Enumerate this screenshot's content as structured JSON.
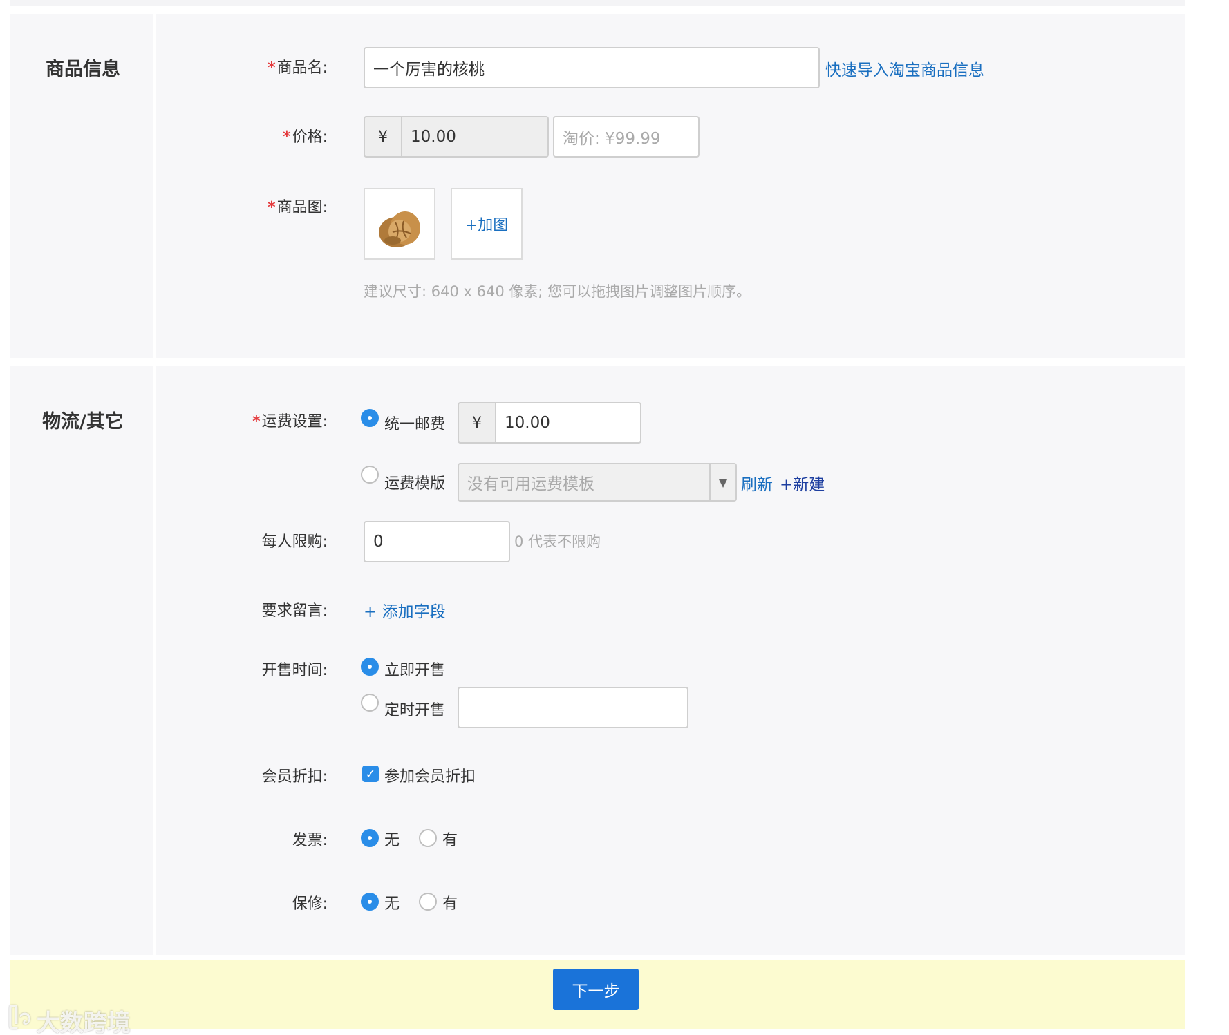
{
  "sections": {
    "product_info_title": "商品信息",
    "logistics_title": "物流/其它"
  },
  "product": {
    "name_label": "商品名:",
    "name_value": "一个厉害的核桃",
    "import_link": "快速导入淘宝商品信息",
    "price_label": "价格:",
    "currency": "¥",
    "price_value": "10.00",
    "taobao_price_placeholder": "淘价: ¥99.99",
    "image_label": "商品图:",
    "add_image": "+加图",
    "image_hint": "建议尺寸: 640 x 640 像素; 您可以拖拽图片调整图片顺序。"
  },
  "logistics": {
    "shipping_label": "运费设置:",
    "uniform_option": "统一邮费",
    "currency": "¥",
    "uniform_value": "10.00",
    "template_option": "运费模版",
    "template_select": "没有可用运费模板",
    "refresh_link": "刷新",
    "new_link": "+新建",
    "limit_label": "每人限购:",
    "limit_value": "0",
    "limit_hint": "0 代表不限购",
    "message_label": "要求留言:",
    "add_field_link": "+ 添加字段",
    "sale_time_label": "开售时间:",
    "sale_now": "立即开售",
    "sale_scheduled": "定时开售",
    "discount_label": "会员折扣:",
    "discount_option": "参加会员折扣",
    "invoice_label": "发票:",
    "warranty_label": "保修:",
    "no": "无",
    "yes": "有"
  },
  "footer": {
    "next_button": "下一步"
  },
  "watermark": "大数跨境",
  "colors": {
    "accent": "#2a8de8",
    "link": "#1a6fc0",
    "required": "#e4393c",
    "footer_bg": "#fcfbd0"
  }
}
